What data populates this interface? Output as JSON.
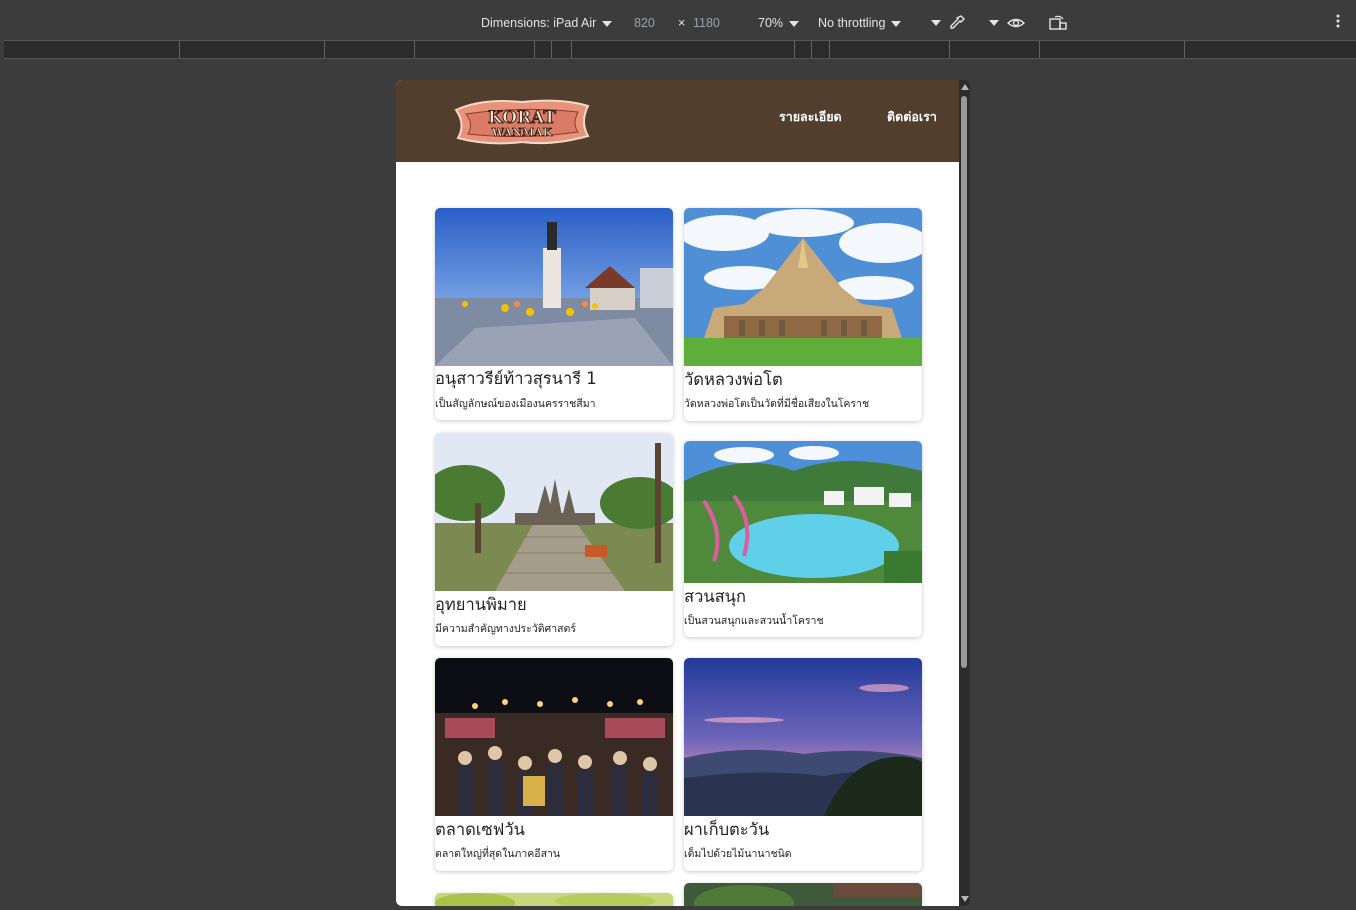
{
  "devtools": {
    "dimensions_label": "Dimensions: iPad Air",
    "width": "820",
    "times": "×",
    "height": "1180",
    "zoom": "70%",
    "throttling": "No throttling"
  },
  "site": {
    "logo_text": "KORAT WANMAK",
    "nav": [
      {
        "label": "รายละเอียด"
      },
      {
        "label": "ติดต่อเรา"
      }
    ]
  },
  "cards": [
    {
      "title": "อนุสาวรีย์ท้าวสุรนารี 1",
      "description": "เป็นสัญลักษณ์ของเมืองนครราชสีมา",
      "image": "monument-photo"
    },
    {
      "title": "วัดหลวงพ่อโต",
      "description": "วัดหลวงพ่อโตเป็นวัดที่มีชื่อเสียงในโคราช",
      "image": "temple-photo"
    },
    {
      "title": "อุทยานพิมาย",
      "description": "มีความสำคัญทางประวัติศาสตร์",
      "image": "phimai-ruins-photo"
    },
    {
      "title": "สวนสนุก",
      "description": "เป็นสวนสนุกและสวนน้ำโคราช",
      "image": "water-park-photo"
    },
    {
      "title": "ตลาดเซฟวัน",
      "description": "ตลาดใหญ่ที่สุดในภาคอีสาน",
      "image": "night-market-photo"
    },
    {
      "title": "ผาเก็บตะวัน",
      "description": "เต็มไปด้วยไม้นานาชนิด",
      "image": "sunset-cliff-photo"
    }
  ]
}
